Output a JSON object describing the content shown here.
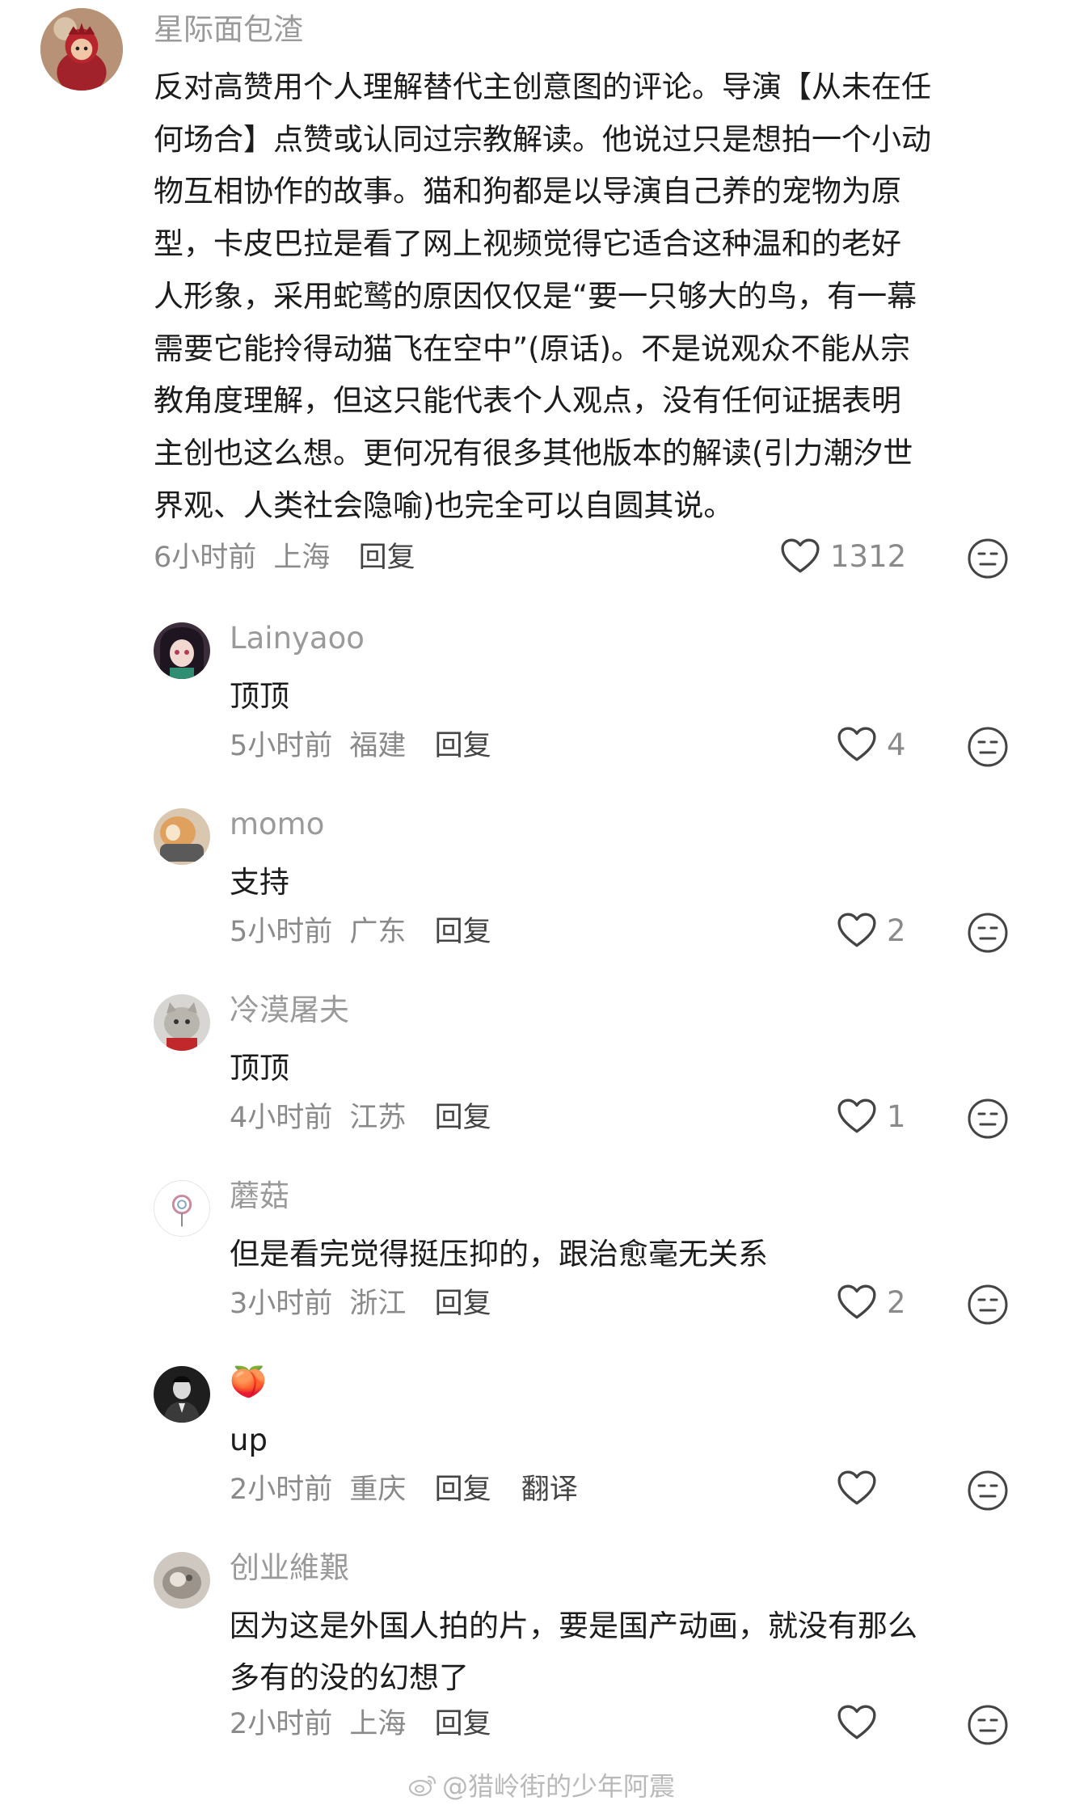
{
  "main_comment": {
    "username": "星际面包渣",
    "lines": [
      "反对高赞用个人理解替代主创意图的评论。导演【从未在任",
      "何场合】点赞或认同过宗教解读。他说过只是想拍一个小动",
      "物互相协作的故事。猫和狗都是以导演自己养的宠物为原",
      "型，卡皮巴拉是看了网上视频觉得它适合这种温和的老好",
      "人形象，采用蛇鹫的原因仅仅是“要一只够大的鸟，有一幕",
      "需要它能拎得动猫飞在空中”(原话)。不是说观众不能从宗",
      "教角度理解，但这只能代表个人观点，没有任何证据表明",
      "主创也这么想。更何况有很多其他版本的解读(引力潮汐世",
      "界观、人类社会隐喻)也完全可以自圆其说。"
    ],
    "time": "6小时前",
    "location": "上海",
    "reply_label": "回复",
    "likes": "1312"
  },
  "replies": [
    {
      "username": "Lainyaoo",
      "lines": [
        "顶顶"
      ],
      "time": "5小时前",
      "location": "福建",
      "reply_label": "回复",
      "likes": "4"
    },
    {
      "username": "momo",
      "lines": [
        "支持"
      ],
      "time": "5小时前",
      "location": "广东",
      "reply_label": "回复",
      "likes": "2"
    },
    {
      "username": "冷漠屠夫",
      "lines": [
        "顶顶"
      ],
      "time": "4小时前",
      "location": "江苏",
      "reply_label": "回复",
      "likes": "1"
    },
    {
      "username": "蘑菇",
      "lines": [
        "但是看完觉得挺压抑的，跟治愈毫无关系"
      ],
      "time": "3小时前",
      "location": "浙江",
      "reply_label": "回复",
      "likes": "2"
    },
    {
      "username": "🍑",
      "lines": [
        "up"
      ],
      "time": "2小时前",
      "location": "重庆",
      "reply_label": "回复",
      "translate_label": "翻译",
      "likes": ""
    },
    {
      "username": "创业維艱",
      "lines": [
        "因为这是外国人拍的片，要是国产动画，就没有那么",
        "多有的没的幻想了"
      ],
      "time": "2小时前",
      "location": "上海",
      "reply_label": "回复",
      "likes": ""
    }
  ],
  "watermark": "@猎岭街的少年阿震",
  "icons": {
    "like": "heart-outline-icon",
    "dislike": "neutral-face-icon",
    "watermark": "weibo-logo-icon"
  },
  "colors": {
    "username": "#9a9a9a",
    "text": "#1c1c1c",
    "meta": "#8a8a8a",
    "icon": "#444444"
  }
}
